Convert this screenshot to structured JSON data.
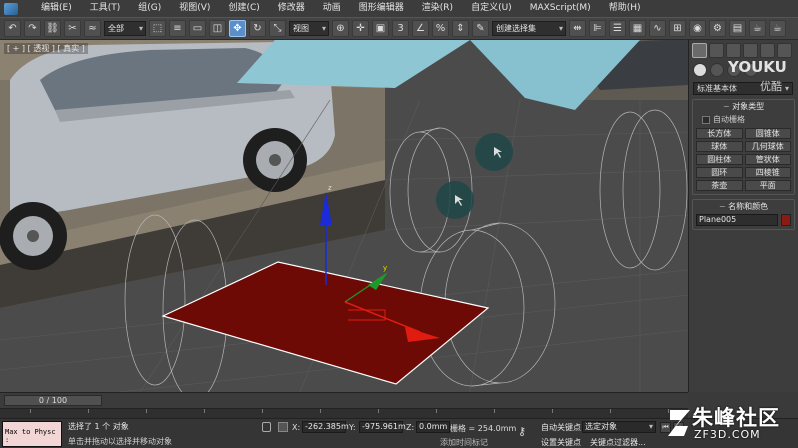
{
  "menu": {
    "items": [
      "编辑(E)",
      "工具(T)",
      "组(G)",
      "视图(V)",
      "创建(C)",
      "修改器",
      "动画",
      "图形编辑器",
      "渲染(R)",
      "自定义(U)",
      "MAXScript(M)",
      "帮助(H)"
    ]
  },
  "toolbar": {
    "filter_dropdown": "全部",
    "ref_coord_dropdown": "视图",
    "snap_numbers": [
      "3",
      "%"
    ],
    "named_selection_dropdown": "创建选择集"
  },
  "viewport": {
    "label": "[ + ] [ 透视 ] [ 真实 ]"
  },
  "command_panel": {
    "primitive_dropdown": "标准基本体",
    "object_type": {
      "title": "对象类型",
      "autogrid_label": "自动栅格",
      "buttons": [
        "长方体",
        "圆锥体",
        "球体",
        "几何球体",
        "圆柱体",
        "管状体",
        "圆环",
        "四棱锥",
        "茶壶",
        "平面"
      ]
    },
    "name_color": {
      "title": "名称和颜色",
      "name_value": "Plane005",
      "color": "#8b1a12"
    }
  },
  "timeline": {
    "slider_label": "0 / 100"
  },
  "status": {
    "maxscript_text": "Max to Physc :",
    "selection_text": "选择了 1 个 对象",
    "prompt_text": "单击并拖动以选择并移动对象",
    "x_label": "X:",
    "x_value": "-262.385m",
    "y_label": "Y:",
    "y_value": "-975.961m",
    "z_label": "Z:",
    "z_value": "0.0mm",
    "grid_text": "栅格 = 254.0mm",
    "add_time_tag": "添加时间标记",
    "autokey_label": "自动关键点",
    "selection_dropdown": "选定对象",
    "setkey_label": "设置关键点",
    "keyfilter_label": "关键点过滤器..."
  },
  "watermarks": {
    "youku_text": "YOUKU",
    "youku_sub": "优酷",
    "site_name": "朱峰社区",
    "site_url": "ZF3D.COM"
  },
  "colors": {
    "plane_fill": "#6e0a06",
    "gizmo_y": "#1b2bd8",
    "gizmo_x": "#e01c10",
    "gizmo_z": "#1f9a2a"
  }
}
